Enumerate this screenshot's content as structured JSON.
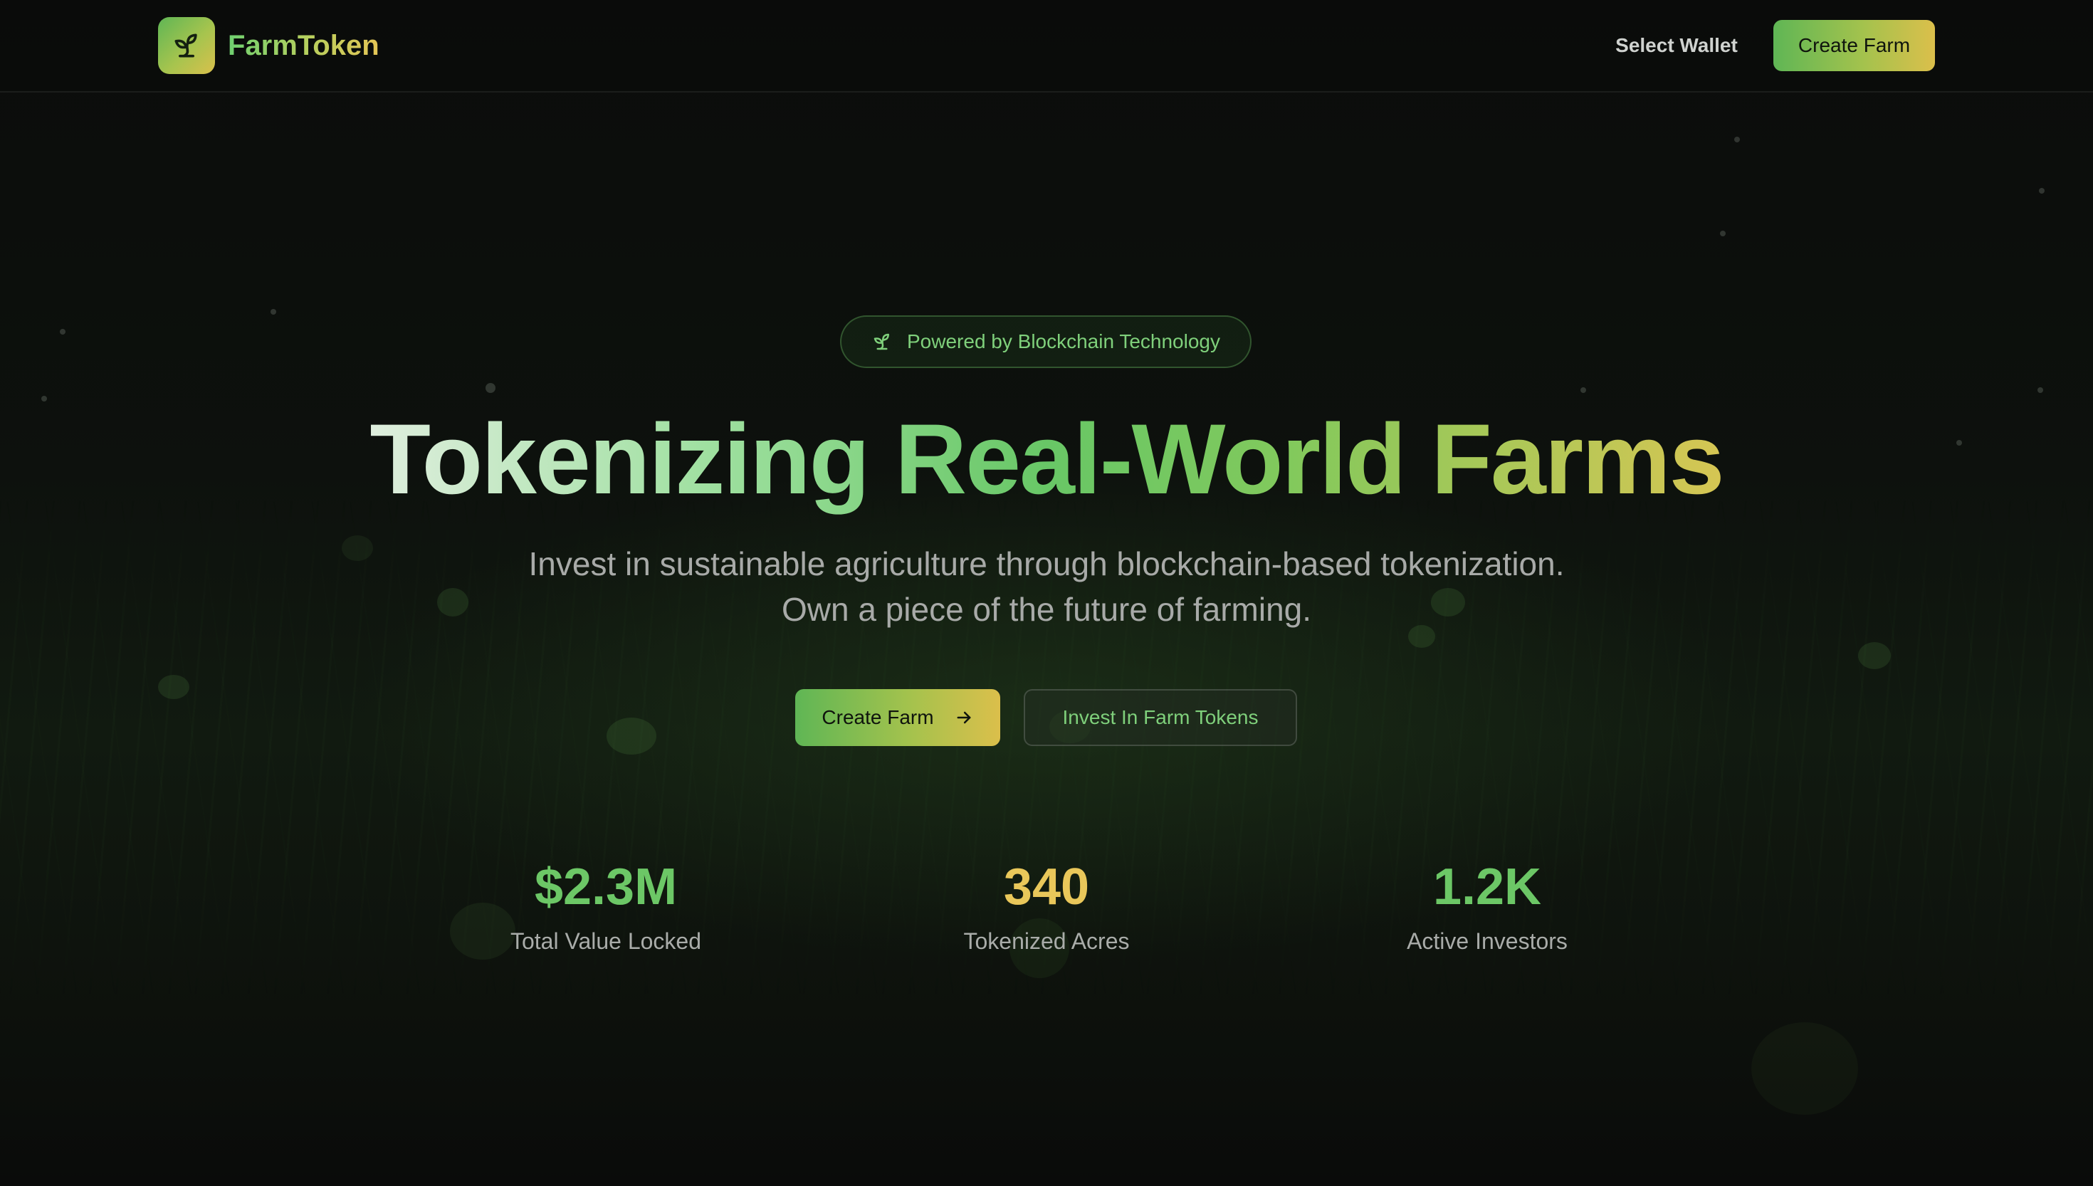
{
  "colors": {
    "accent_green": "#6cc766",
    "accent_gold": "#e9c75a",
    "background": "#0a0b0a"
  },
  "nav": {
    "brand": "FarmToken",
    "brand_icon": "sprout-icon",
    "wallet_label": "Select Wallet",
    "create_label": "Create Farm"
  },
  "hero": {
    "badge": "Powered by Blockchain Technology",
    "badge_icon": "sprout-icon",
    "title": "Tokenizing Real-World Farms",
    "subtitle_line1": "Invest in sustainable agriculture through blockchain-based tokenization.",
    "subtitle_line2": "Own a piece of the future of farming.",
    "primary_cta": "Create Farm",
    "primary_cta_icon": "arrow-right-icon",
    "secondary_cta": "Invest In Farm Tokens"
  },
  "stats": [
    {
      "value": "$2.3M",
      "label": "Total Value Locked",
      "color": "#6cc766"
    },
    {
      "value": "340",
      "label": "Tokenized Acres",
      "color": "#e9c75a"
    },
    {
      "value": "1.2K",
      "label": "Active Investors",
      "color": "#6cc766"
    }
  ]
}
